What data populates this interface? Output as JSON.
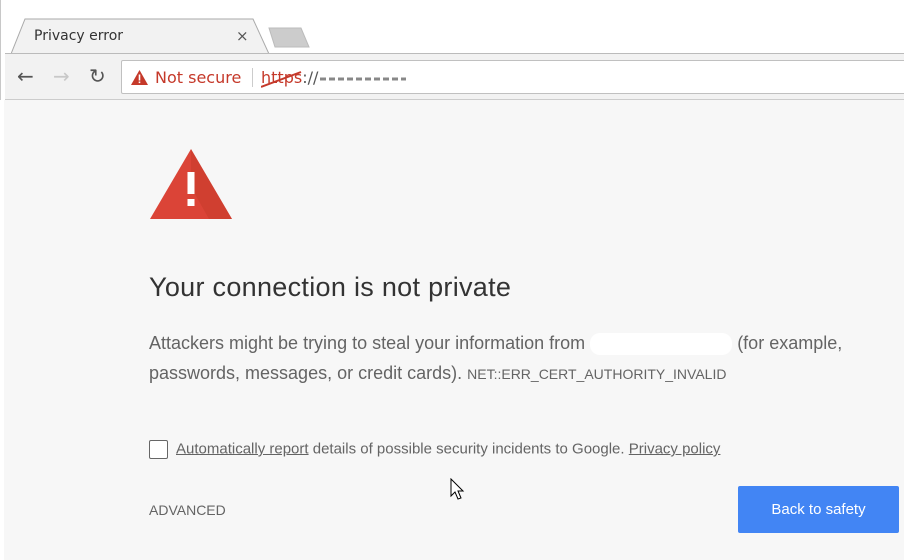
{
  "tab": {
    "title": "Privacy error",
    "close_icon": "×"
  },
  "toolbar": {
    "back_icon": "←",
    "forward_icon": "→",
    "reload_icon": "↻"
  },
  "omnibox": {
    "security_label": "Not secure",
    "url_scheme": "https",
    "url_rest": "://"
  },
  "page": {
    "heading": "Your connection is not private",
    "desc_before": "Attackers might be trying to steal your information from ",
    "desc_after": " (for example, passwords, messages, or credit cards). ",
    "error_code": "NET::ERR_CERT_AUTHORITY_INVALID",
    "report_link": "Automatically report",
    "report_text": " details of possible security incidents to Google. ",
    "privacy_link": "Privacy policy",
    "advanced": "ADVANCED",
    "back_button": "Back to safety"
  },
  "colors": {
    "danger": "#d93025",
    "primary": "#4285f4"
  }
}
